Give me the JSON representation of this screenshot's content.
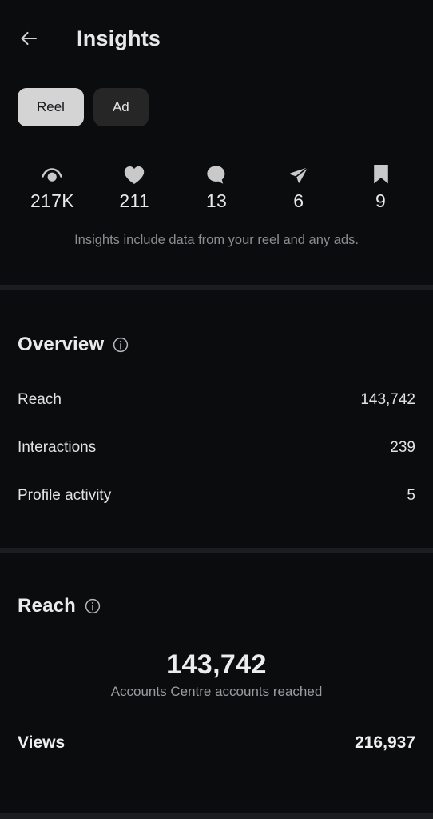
{
  "header": {
    "back_label": "Back",
    "back_icon": "arrow-left-icon",
    "title": "Insights"
  },
  "filters": {
    "options": [
      {
        "label": "Reel",
        "selected": true
      },
      {
        "label": "Ad",
        "selected": false
      }
    ]
  },
  "engagement": {
    "stats": [
      {
        "icon": "views-icon",
        "name": "views",
        "value": "217K"
      },
      {
        "icon": "heart-icon",
        "name": "likes",
        "value": "211"
      },
      {
        "icon": "comment-icon",
        "name": "comments",
        "value": "13"
      },
      {
        "icon": "share-icon",
        "name": "shares",
        "value": "6"
      },
      {
        "icon": "bookmark-icon",
        "name": "saves",
        "value": "9"
      }
    ],
    "note": "Insights include data from your reel and any ads."
  },
  "overview": {
    "title": "Overview",
    "info_icon": "info-icon",
    "rows": [
      {
        "label": "Reach",
        "value": "143,742"
      },
      {
        "label": "Interactions",
        "value": "239"
      },
      {
        "label": "Profile activity",
        "value": "5"
      }
    ]
  },
  "reach": {
    "title": "Reach",
    "info_icon": "info-icon",
    "highlight": {
      "value": "143,742",
      "caption": "Accounts Centre accounts reached"
    },
    "rows": [
      {
        "label": "Views",
        "value": "216,937"
      }
    ]
  },
  "colors": {
    "background": "#0b0c0e",
    "divider": "#1b1d21",
    "pill_selected_bg": "#d4d4d4",
    "pill_unselected_bg": "#262626",
    "text_primary": "#e9e9e9",
    "text_muted": "#8b8d91",
    "icon": "#c9c9c9"
  }
}
